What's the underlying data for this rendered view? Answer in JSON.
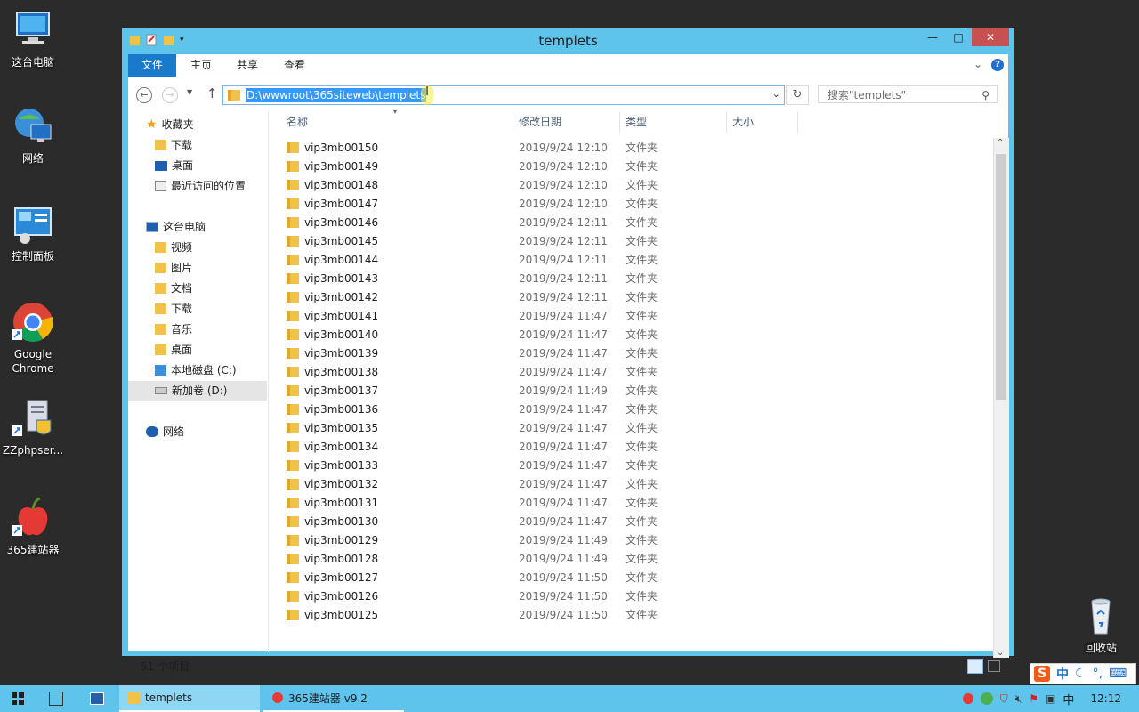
{
  "desktop": {
    "icons": [
      {
        "label": "这台电脑",
        "icon": "computer-icon"
      },
      {
        "label": "网络",
        "icon": "network-icon"
      },
      {
        "label": "控制面板",
        "icon": "control-panel-icon"
      },
      {
        "label": "Google\nChrome",
        "label1": "Google",
        "label2": "Chrome",
        "icon": "chrome-icon"
      },
      {
        "label": "ZZphpser...",
        "icon": "zzphpserver-icon"
      },
      {
        "label": "365建站器",
        "icon": "apple-icon"
      },
      {
        "label": "回收站",
        "icon": "recycle-bin-icon"
      }
    ]
  },
  "window": {
    "title": "templets",
    "buttons": {
      "minimize": "—",
      "maximize": "□",
      "close": "✕"
    }
  },
  "ribbon": {
    "tabs": [
      "文件",
      "主页",
      "共享",
      "查看"
    ]
  },
  "address": {
    "path": "D:\\wwwroot\\365siteweb\\templets",
    "search_placeholder": "搜索\"templets\""
  },
  "navpane": {
    "favorites": "收藏夹",
    "fav_items": [
      "下载",
      "桌面",
      "最近访问的位置"
    ],
    "this_pc": "这台电脑",
    "pc_items": [
      "视频",
      "图片",
      "文档",
      "下载",
      "音乐",
      "桌面",
      "本地磁盘 (C:)",
      "新加卷 (D:)"
    ],
    "network": "网络"
  },
  "columns": [
    "名称",
    "修改日期",
    "类型",
    "大小"
  ],
  "files": [
    {
      "name": "vip3mb00150",
      "date": "2019/9/24 12:10",
      "type": "文件夹"
    },
    {
      "name": "vip3mb00149",
      "date": "2019/9/24 12:10",
      "type": "文件夹"
    },
    {
      "name": "vip3mb00148",
      "date": "2019/9/24 12:10",
      "type": "文件夹"
    },
    {
      "name": "vip3mb00147",
      "date": "2019/9/24 12:10",
      "type": "文件夹"
    },
    {
      "name": "vip3mb00146",
      "date": "2019/9/24 12:11",
      "type": "文件夹"
    },
    {
      "name": "vip3mb00145",
      "date": "2019/9/24 12:11",
      "type": "文件夹"
    },
    {
      "name": "vip3mb00144",
      "date": "2019/9/24 12:11",
      "type": "文件夹"
    },
    {
      "name": "vip3mb00143",
      "date": "2019/9/24 12:11",
      "type": "文件夹"
    },
    {
      "name": "vip3mb00142",
      "date": "2019/9/24 12:11",
      "type": "文件夹"
    },
    {
      "name": "vip3mb00141",
      "date": "2019/9/24 11:47",
      "type": "文件夹"
    },
    {
      "name": "vip3mb00140",
      "date": "2019/9/24 11:47",
      "type": "文件夹"
    },
    {
      "name": "vip3mb00139",
      "date": "2019/9/24 11:47",
      "type": "文件夹"
    },
    {
      "name": "vip3mb00138",
      "date": "2019/9/24 11:47",
      "type": "文件夹"
    },
    {
      "name": "vip3mb00137",
      "date": "2019/9/24 11:49",
      "type": "文件夹"
    },
    {
      "name": "vip3mb00136",
      "date": "2019/9/24 11:47",
      "type": "文件夹"
    },
    {
      "name": "vip3mb00135",
      "date": "2019/9/24 11:47",
      "type": "文件夹"
    },
    {
      "name": "vip3mb00134",
      "date": "2019/9/24 11:47",
      "type": "文件夹"
    },
    {
      "name": "vip3mb00133",
      "date": "2019/9/24 11:47",
      "type": "文件夹"
    },
    {
      "name": "vip3mb00132",
      "date": "2019/9/24 11:47",
      "type": "文件夹"
    },
    {
      "name": "vip3mb00131",
      "date": "2019/9/24 11:47",
      "type": "文件夹"
    },
    {
      "name": "vip3mb00130",
      "date": "2019/9/24 11:47",
      "type": "文件夹"
    },
    {
      "name": "vip3mb00129",
      "date": "2019/9/24 11:49",
      "type": "文件夹"
    },
    {
      "name": "vip3mb00128",
      "date": "2019/9/24 11:49",
      "type": "文件夹"
    },
    {
      "name": "vip3mb00127",
      "date": "2019/9/24 11:50",
      "type": "文件夹"
    },
    {
      "name": "vip3mb00126",
      "date": "2019/9/24 11:50",
      "type": "文件夹"
    },
    {
      "name": "vip3mb00125",
      "date": "2019/9/24 11:50",
      "type": "文件夹"
    }
  ],
  "status": {
    "count": "51 个项目"
  },
  "taskbar": {
    "items": [
      "templets",
      "365建站器 v9.2"
    ],
    "ime_lang": "中",
    "clock": "12:12"
  },
  "ime": {
    "lang": "中"
  },
  "colors": {
    "accent": "#5fc4ec",
    "file_tab": "#1979ca",
    "selection": "#3399ff",
    "folder": "#f0c24a"
  }
}
